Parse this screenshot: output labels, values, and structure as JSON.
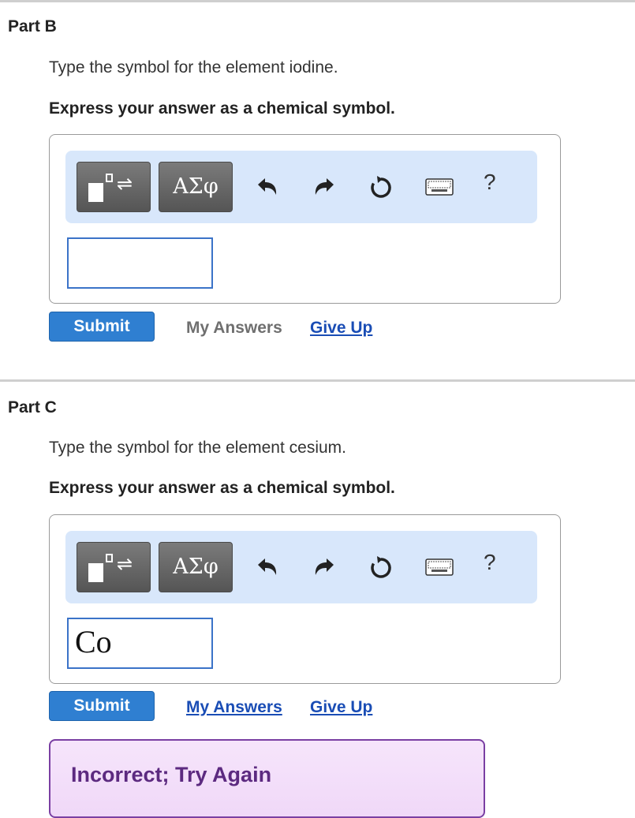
{
  "parts": [
    {
      "title": "Part B",
      "prompt": "Type the symbol for the element iodine.",
      "instruction": "Express your answer as a chemical symbol.",
      "toolbar": {
        "greek_label": "ΑΣφ",
        "help_label": "?",
        "icons": [
          "templates-icon",
          "undo-icon",
          "redo-icon",
          "reset-icon",
          "keyboard-icon"
        ]
      },
      "answer_value": "",
      "submit_label": "Submit",
      "my_answers_label": "My Answers",
      "give_up_label": "Give Up"
    },
    {
      "title": "Part C",
      "prompt": "Type the symbol for the element cesium.",
      "instruction": "Express your answer as a chemical symbol.",
      "toolbar": {
        "greek_label": "ΑΣφ",
        "help_label": "?",
        "icons": [
          "templates-icon",
          "undo-icon",
          "redo-icon",
          "reset-icon",
          "keyboard-icon"
        ]
      },
      "answer_value": "Co",
      "submit_label": "Submit",
      "my_answers_label": "My Answers",
      "give_up_label": "Give Up",
      "feedback": "Incorrect; Try Again"
    }
  ],
  "colors": {
    "submit": "#2f7fd1",
    "link_active": "#1a4db5",
    "link_disabled": "#6f6f6f",
    "toolbar_bg": "#d8e7fb",
    "feedback_border": "#7a3fa3",
    "feedback_text": "#5c2a80"
  }
}
